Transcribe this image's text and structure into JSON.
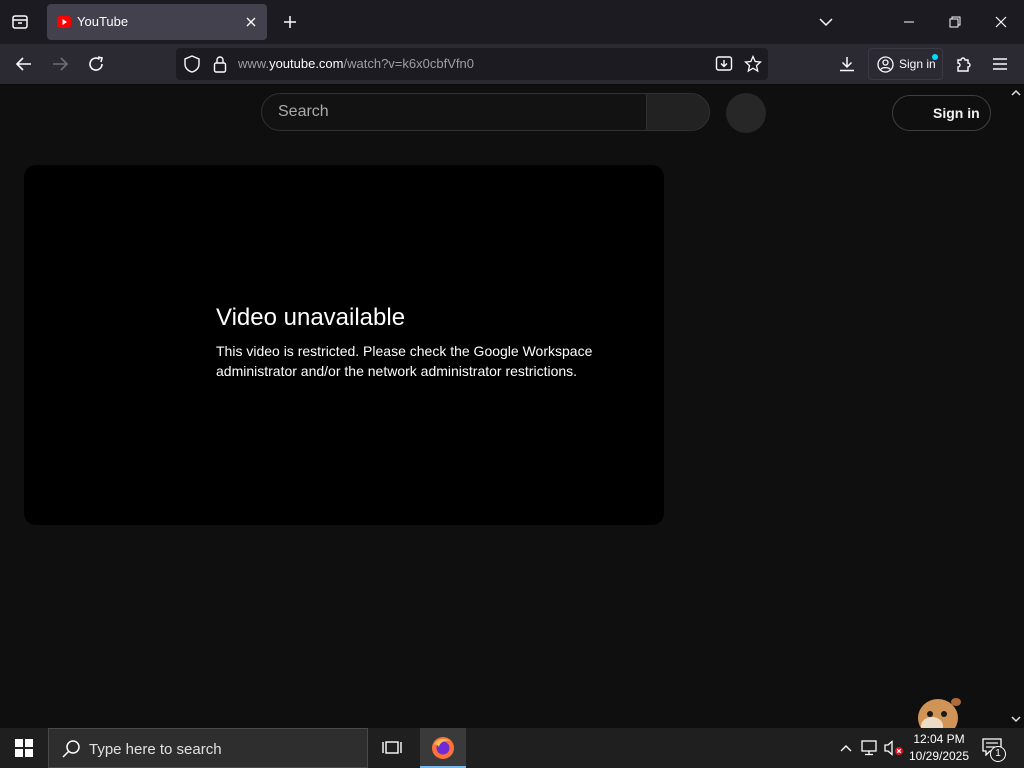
{
  "browser": {
    "tab": {
      "title": "YouTube"
    },
    "url": {
      "prefix": "www.",
      "domain": "youtube.com",
      "path": "/watch?v=k6x0cbfVfn0"
    },
    "account_button": {
      "label": "Sign in"
    }
  },
  "youtube": {
    "search": {
      "placeholder": "Search"
    },
    "sign_in_label": "Sign in",
    "player": {
      "error_title": "Video unavailable",
      "error_message": "This video is restricted. Please check the Google Workspace administrator and/or the network administrator restrictions."
    }
  },
  "taskbar": {
    "search_placeholder": "Type here to search",
    "clock": {
      "time": "12:04 PM",
      "date": "10/29/2025"
    },
    "notification_count": "1"
  },
  "colors": {
    "youtube_red": "#ff0000",
    "page_bg": "#0f0f0f",
    "browser_chrome": "#1c1b22",
    "accent_dot": "#00ddff"
  }
}
